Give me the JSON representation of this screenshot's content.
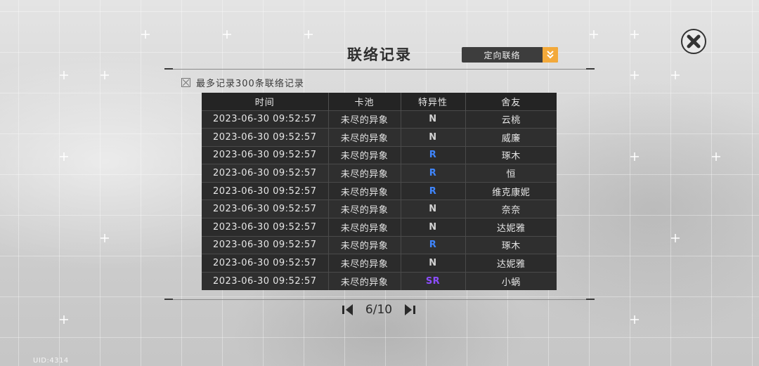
{
  "title": "联络记录",
  "dropdown": {
    "selected": "定向联络"
  },
  "note": "最多记录300条联络记录",
  "table": {
    "headers": [
      "时间",
      "卡池",
      "特异性",
      "舍友"
    ],
    "rows": [
      {
        "time": "2023-06-30 09:52:57",
        "pool": "未尽的异象",
        "rarity": "N",
        "name": "云桃"
      },
      {
        "time": "2023-06-30 09:52:57",
        "pool": "未尽的异象",
        "rarity": "N",
        "name": "威廉"
      },
      {
        "time": "2023-06-30 09:52:57",
        "pool": "未尽的异象",
        "rarity": "R",
        "name": "琢木"
      },
      {
        "time": "2023-06-30 09:52:57",
        "pool": "未尽的异象",
        "rarity": "R",
        "name": "恒"
      },
      {
        "time": "2023-06-30 09:52:57",
        "pool": "未尽的异象",
        "rarity": "R",
        "name": "维克康妮"
      },
      {
        "time": "2023-06-30 09:52:57",
        "pool": "未尽的异象",
        "rarity": "N",
        "name": "奈奈"
      },
      {
        "time": "2023-06-30 09:52:57",
        "pool": "未尽的异象",
        "rarity": "N",
        "name": "达妮雅"
      },
      {
        "time": "2023-06-30 09:52:57",
        "pool": "未尽的异象",
        "rarity": "R",
        "name": "琢木"
      },
      {
        "time": "2023-06-30 09:52:57",
        "pool": "未尽的异象",
        "rarity": "N",
        "name": "达妮雅"
      },
      {
        "time": "2023-06-30 09:52:57",
        "pool": "未尽的异象",
        "rarity": "SR",
        "name": "小蜗"
      }
    ]
  },
  "pager": {
    "label": "6/10"
  },
  "uid": "UID:4314",
  "icons": {
    "close": "close-x-icon",
    "dropdown": "chevron-down-icon",
    "prev": "triangle-left-icon",
    "next": "triangle-right-icon",
    "checkbox": "checkbox-icon"
  },
  "colors": {
    "accent": "#f3a93a",
    "rarity_N": "#d2d2d2",
    "rarity_R": "#3f86ff",
    "rarity_SR": "#8c4dff",
    "table_bg": "#2b2b2b"
  }
}
